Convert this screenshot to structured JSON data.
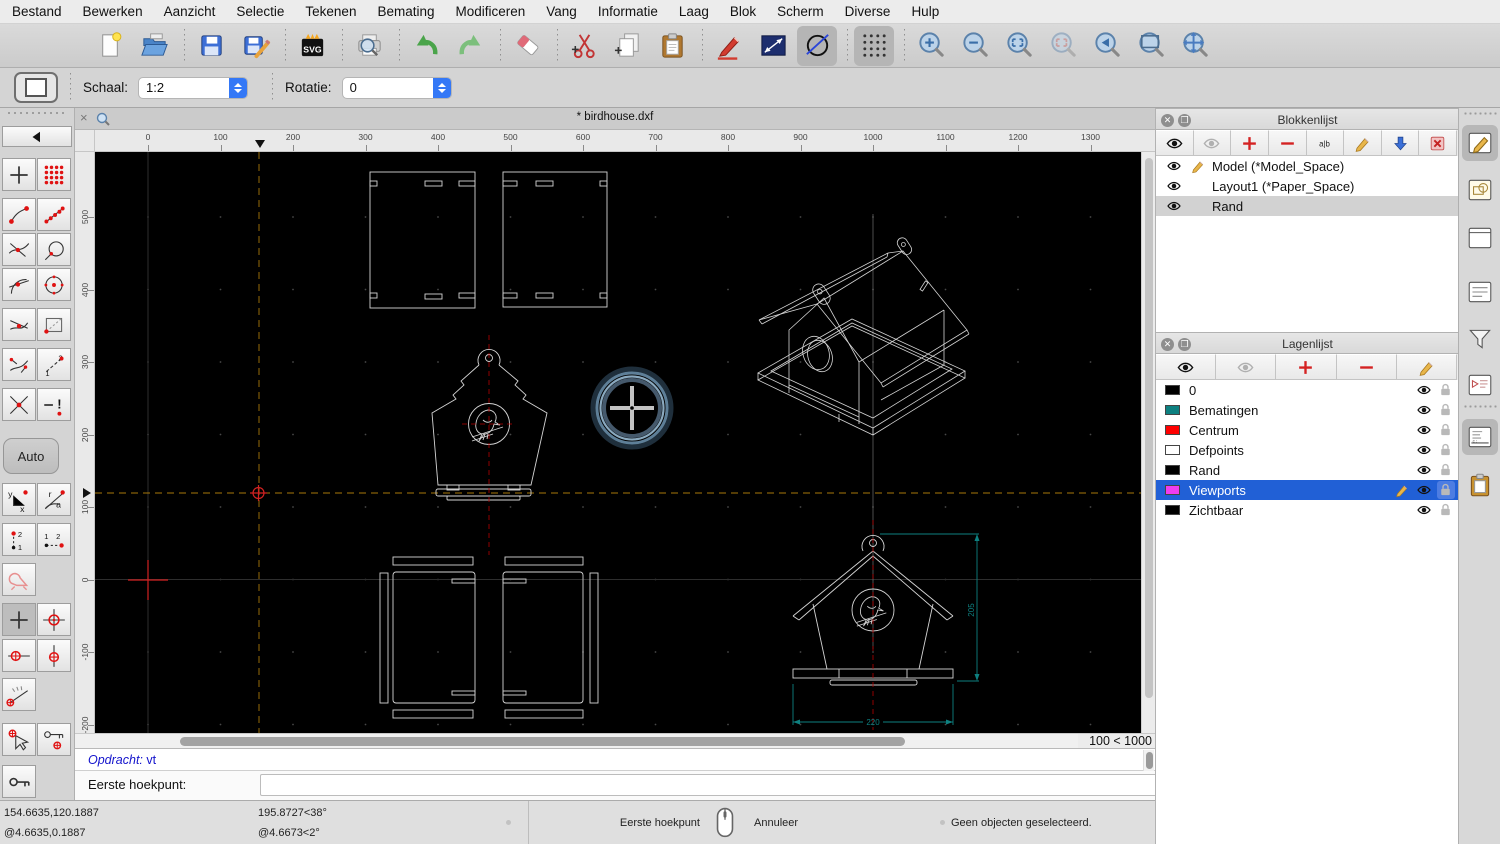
{
  "menu_bar": {
    "items": [
      "Bestand",
      "Bewerken",
      "Aanzicht",
      "Selectie",
      "Tekenen",
      "Bemating",
      "Modificeren",
      "Vang",
      "Informatie",
      "Laag",
      "Blok",
      "Scherm",
      "Diverse",
      "Hulp"
    ]
  },
  "toolbar": {
    "groups": [
      [
        {
          "icon": "new-document-icon"
        },
        {
          "icon": "open-file-icon"
        }
      ],
      [
        {
          "icon": "save-icon"
        },
        {
          "icon": "save-as-icon"
        }
      ],
      [
        {
          "icon": "svg-export-icon"
        }
      ],
      [
        {
          "icon": "print-preview-icon"
        }
      ],
      [
        {
          "icon": "undo-icon"
        },
        {
          "icon": "redo-icon"
        }
      ],
      [
        {
          "icon": "delete-eraser-icon"
        }
      ],
      [
        {
          "icon": "cut-icon"
        },
        {
          "icon": "copy-icon"
        },
        {
          "icon": "paste-icon"
        }
      ],
      [
        {
          "icon": "draw-pencil-icon"
        },
        {
          "icon": "distance-line-icon"
        },
        {
          "icon": "circle-tool-icon",
          "pressed": true
        }
      ],
      [
        {
          "icon": "grid-toggle-icon",
          "pressed": true
        }
      ],
      [
        {
          "icon": "zoom-in-icon"
        },
        {
          "icon": "zoom-out-icon"
        },
        {
          "icon": "zoom-auto-icon"
        },
        {
          "icon": "zoom-selection-icon",
          "disabled": true
        },
        {
          "icon": "zoom-previous-icon"
        },
        {
          "icon": "zoom-window-icon"
        },
        {
          "icon": "zoom-pan-icon"
        }
      ]
    ]
  },
  "options_bar": {
    "scale_label": "Schaal:",
    "scale_value": "1:2",
    "rotation_label": "Rotatie:",
    "rotation_value": "0"
  },
  "document": {
    "tab_title": "* birdhouse.dxf",
    "close_glyph": "×"
  },
  "rulers": {
    "horizontal_ticks": [
      "0",
      "100",
      "200",
      "300",
      "400",
      "500",
      "600",
      "700",
      "800",
      "900",
      "1000",
      "1100",
      "1200",
      "1300"
    ],
    "vertical_ticks": [
      "500",
      "400",
      "300",
      "200",
      "100",
      "0",
      "-100",
      "-200"
    ]
  },
  "left_palette": {
    "auto_label": "Auto",
    "back_icon": "back-arrow-icon",
    "tool_rows": [
      [
        "free-snap-icon",
        "grid-snap-icon"
      ],
      [
        "endpoint-snap-icon",
        "on-entity-points-icon"
      ],
      [
        "intersection-auto-snap-icon",
        "entity-snap-icon"
      ],
      [
        "tangent-snap-icon",
        "center-snap-icon"
      ],
      [
        "nearest-snap-icon",
        "reference-snap-icon"
      ],
      [
        "perpendicular-snap-icon",
        "distance-snap-icon"
      ],
      [
        "intersection-snap-icon",
        "restrict-off-icon"
      ],
      [
        "coordinate-xy-icon",
        "coordinate-polar-icon"
      ],
      [
        "relative-point-v-icon",
        "relative-point-h-icon"
      ],
      [
        "restrict-ortho-icon",
        null
      ],
      [
        "crosshair-plain-icon",
        "set-relative-zero-icon"
      ],
      [
        "restrict-horizontal-icon",
        "restrict-vertical-icon"
      ],
      [
        "angle-gauge-icon",
        null
      ],
      [
        "pick-relative-zero-icon",
        "lock-relative-zero-icon"
      ],
      [
        "lock-zero-icon",
        null
      ]
    ]
  },
  "canvas": {
    "zoom_indicator": "100 < 1000",
    "dimensions": {
      "height_label": "205",
      "width_label": "220"
    }
  },
  "command_line": {
    "history_prompt": "Opdracht:",
    "history_value": "vt",
    "prompt": "Eerste hoekpunt:"
  },
  "status_bar": {
    "abs_coord": "154.6635,120.1887",
    "rel_coord": "@4.6635,0.1887",
    "polar_abs": "195.8727<38°",
    "polar_rel": "@4.6673<2°",
    "left_click_label": "Eerste hoekpunt",
    "right_click_label": "Annuleer",
    "selection_status": "Geen objecten geselecteerd."
  },
  "block_list": {
    "title": "Blokkenlijst",
    "toolbar_icons": [
      "show-all-eye-icon",
      "hide-all-eye-icon",
      "add-block-icon",
      "remove-block-icon",
      "rename-block-icon",
      "edit-block-icon",
      "insert-block-icon",
      "delete-block-icon"
    ],
    "items": [
      {
        "label": "Model (*Model_Space)",
        "visible": true,
        "editing": true,
        "selected": false
      },
      {
        "label": "Layout1 (*Paper_Space)",
        "visible": true,
        "editing": false,
        "selected": false
      },
      {
        "label": "Rand",
        "visible": true,
        "editing": false,
        "selected": true
      }
    ]
  },
  "layer_list": {
    "title": "Lagenlijst",
    "toolbar_icons": [
      "show-all-eye-icon",
      "hide-all-eye-icon",
      "add-layer-icon",
      "remove-layer-icon",
      "edit-layer-icon"
    ],
    "items": [
      {
        "label": "0",
        "color": "#000000",
        "selected": false
      },
      {
        "label": "Bematingen",
        "color": "#0d8080",
        "selected": false
      },
      {
        "label": "Centrum",
        "color": "#ff0000",
        "selected": false
      },
      {
        "label": "Defpoints",
        "color": "#ffffff",
        "selected": false
      },
      {
        "label": "Rand",
        "color": "#000000",
        "selected": false
      },
      {
        "label": "Viewports",
        "color": "#f03cf0",
        "selected": true,
        "editing": true
      },
      {
        "label": "Zichtbaar",
        "color": "#000000",
        "selected": false
      }
    ]
  },
  "dock_strip": {
    "buttons": [
      {
        "icon": "dock-block-edit-icon",
        "pressed": true
      },
      {
        "icon": "dock-shapes-icon",
        "pressed": false
      },
      {
        "icon": "dock-viewport-icon",
        "pressed": false
      },
      {
        "icon": "dock-list-icon",
        "pressed": false
      },
      {
        "icon": "dock-filter-icon",
        "pressed": false
      },
      {
        "icon": "dock-render-icon",
        "pressed": false
      },
      {
        "icon": "dock-command-icon",
        "pressed": true
      },
      {
        "icon": "dock-clipboard-icon",
        "pressed": false
      }
    ]
  },
  "colors": {
    "selection_blue": "#2160d6",
    "dimension_teal": "#0e8080",
    "centerline_red": "#b40000",
    "tracking_orange": "#a8790a",
    "drawing_line": "#d4d4d4"
  }
}
